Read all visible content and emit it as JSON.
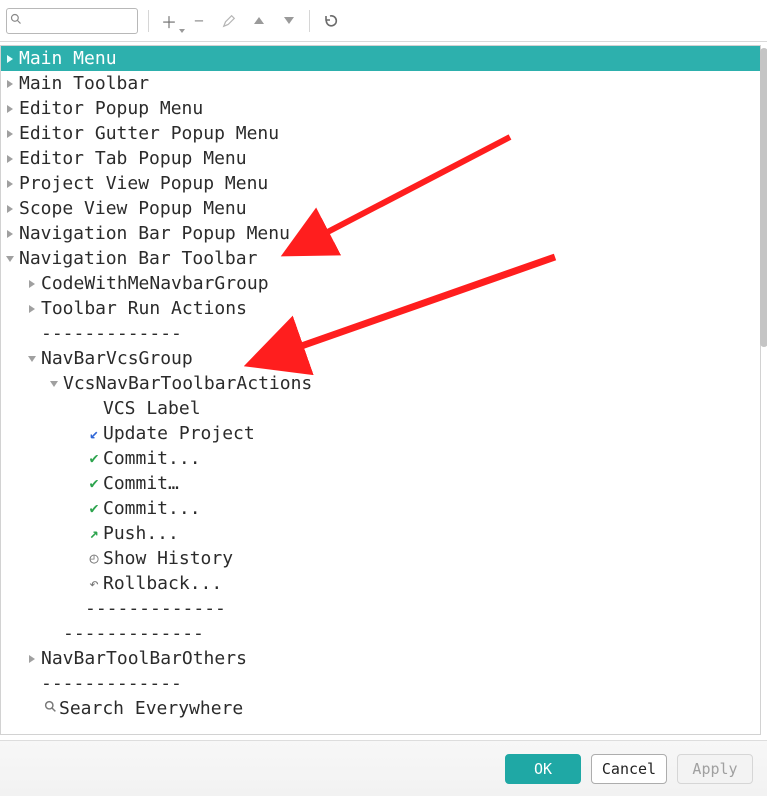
{
  "toolbar": {
    "search_placeholder": ""
  },
  "tree": {
    "items": [
      {
        "indent": 0,
        "arrow": "right",
        "selected": true,
        "icon": null,
        "label": "Main Menu"
      },
      {
        "indent": 0,
        "arrow": "right",
        "selected": false,
        "icon": null,
        "label": "Main Toolbar"
      },
      {
        "indent": 0,
        "arrow": "right",
        "selected": false,
        "icon": null,
        "label": "Editor Popup Menu"
      },
      {
        "indent": 0,
        "arrow": "right",
        "selected": false,
        "icon": null,
        "label": "Editor Gutter Popup Menu"
      },
      {
        "indent": 0,
        "arrow": "right",
        "selected": false,
        "icon": null,
        "label": "Editor Tab Popup Menu"
      },
      {
        "indent": 0,
        "arrow": "right",
        "selected": false,
        "icon": null,
        "label": "Project View Popup Menu"
      },
      {
        "indent": 0,
        "arrow": "right",
        "selected": false,
        "icon": null,
        "label": "Scope View Popup Menu"
      },
      {
        "indent": 0,
        "arrow": "right",
        "selected": false,
        "icon": null,
        "label": "Navigation Bar Popup Menu"
      },
      {
        "indent": 0,
        "arrow": "down",
        "selected": false,
        "icon": null,
        "label": "Navigation Bar Toolbar"
      },
      {
        "indent": 1,
        "arrow": "right",
        "selected": false,
        "icon": null,
        "label": "CodeWithMeNavbarGroup"
      },
      {
        "indent": 1,
        "arrow": "right",
        "selected": false,
        "icon": null,
        "label": "Toolbar Run Actions"
      },
      {
        "indent": 1,
        "arrow": "none",
        "selected": false,
        "icon": "sep",
        "label": "-------------"
      },
      {
        "indent": 1,
        "arrow": "down",
        "selected": false,
        "icon": null,
        "label": "NavBarVcsGroup"
      },
      {
        "indent": 2,
        "arrow": "down",
        "selected": false,
        "icon": null,
        "label": "VcsNavBarToolbarActions"
      },
      {
        "indent": 3,
        "arrow": "none",
        "selected": false,
        "icon": null,
        "label": "VCS Label"
      },
      {
        "indent": 3,
        "arrow": "none",
        "selected": false,
        "icon": "down-left",
        "label": "Update Project"
      },
      {
        "indent": 3,
        "arrow": "none",
        "selected": false,
        "icon": "check",
        "label": "Commit..."
      },
      {
        "indent": 3,
        "arrow": "none",
        "selected": false,
        "icon": "check",
        "label": "Commit…"
      },
      {
        "indent": 3,
        "arrow": "none",
        "selected": false,
        "icon": "check",
        "label": "Commit..."
      },
      {
        "indent": 3,
        "arrow": "none",
        "selected": false,
        "icon": "up-right",
        "label": "Push..."
      },
      {
        "indent": 3,
        "arrow": "none",
        "selected": false,
        "icon": "clock",
        "label": "Show History"
      },
      {
        "indent": 3,
        "arrow": "none",
        "selected": false,
        "icon": "rollback",
        "label": "Rollback..."
      },
      {
        "indent": 3,
        "arrow": "none",
        "selected": false,
        "icon": "sep",
        "label": "-------------"
      },
      {
        "indent": 2,
        "arrow": "none",
        "selected": false,
        "icon": "sep",
        "label": "-------------"
      },
      {
        "indent": 1,
        "arrow": "right",
        "selected": false,
        "icon": null,
        "label": "NavBarToolBarOthers"
      },
      {
        "indent": 1,
        "arrow": "none",
        "selected": false,
        "icon": "sep",
        "label": "-------------"
      },
      {
        "indent": 1,
        "arrow": "none",
        "selected": false,
        "icon": "search",
        "label": "Search Everywhere"
      }
    ]
  },
  "buttons": {
    "ok": "OK",
    "cancel": "Cancel",
    "apply": "Apply"
  }
}
